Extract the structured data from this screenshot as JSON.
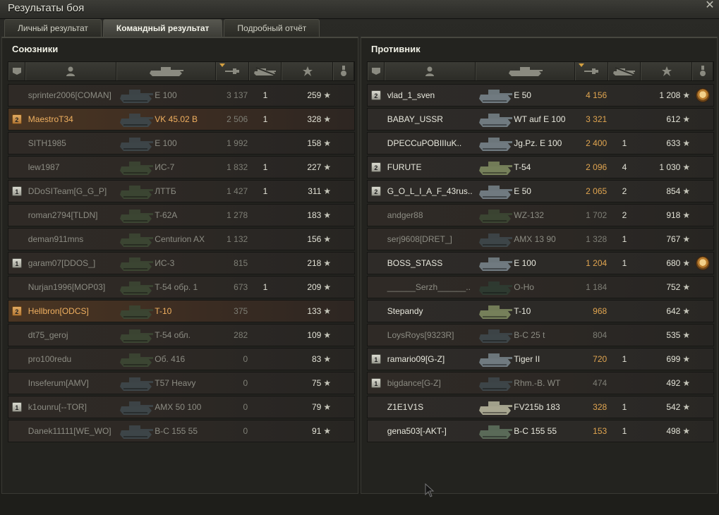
{
  "window": {
    "title": "Результаты боя",
    "close_icon": "close-icon"
  },
  "tabs": [
    {
      "label": "Личный результат",
      "active": false
    },
    {
      "label": "Командный результат",
      "active": true
    },
    {
      "label": "Подробный отчёт",
      "active": false
    }
  ],
  "allies": {
    "title": "Союзники",
    "columns": [
      {
        "icon": "platoon-icon"
      },
      {
        "icon": "player-icon"
      },
      {
        "icon": "tank-icon"
      },
      {
        "icon": "damage-icon",
        "sorted": true
      },
      {
        "icon": "kills-icon"
      },
      {
        "icon": "xp-star-icon"
      },
      {
        "icon": "medal-icon"
      }
    ],
    "rows": [
      {
        "platoon": "",
        "name": "sprinter2006[COMAN]",
        "vehicle": "E 100",
        "damage": "3 137",
        "kills": "1",
        "xp": "259",
        "state": "dead",
        "medal": false,
        "tank_color": "#3d4548"
      },
      {
        "platoon": "2",
        "platoon_color": "gold",
        "name": "MaestroT34",
        "vehicle": "VK 45.02 B",
        "damage": "2 506",
        "kills": "1",
        "xp": "328",
        "state": "highlight",
        "medal": false,
        "tank_color": "#3d4548"
      },
      {
        "platoon": "",
        "name": "SITH1985",
        "vehicle": "E 100",
        "damage": "1 992",
        "kills": "",
        "xp": "158",
        "state": "dead",
        "medal": false,
        "tank_color": "#3d4548"
      },
      {
        "platoon": "",
        "name": "lew1987",
        "vehicle": "ИС-7",
        "damage": "1 832",
        "kills": "1",
        "xp": "227",
        "state": "dead",
        "medal": false,
        "tank_color": "#3b4532"
      },
      {
        "platoon": "1",
        "platoon_color": "silver",
        "name": "DDoSITeam[G_G_P]",
        "vehicle": "ЛТТБ",
        "damage": "1 427",
        "kills": "1",
        "xp": "311",
        "state": "dead",
        "medal": false,
        "tank_color": "#3b4532"
      },
      {
        "platoon": "",
        "name": "roman2794[TLDN]",
        "vehicle": "T-62A",
        "damage": "1 278",
        "kills": "",
        "xp": "183",
        "state": "dead",
        "medal": false,
        "tank_color": "#3b4532"
      },
      {
        "platoon": "",
        "name": "deman911mns",
        "vehicle": "Centurion AX",
        "damage": "1 132",
        "kills": "",
        "xp": "156",
        "state": "dead",
        "medal": false,
        "tank_color": "#3b4532"
      },
      {
        "platoon": "1",
        "platoon_color": "silver",
        "name": "garam07[DDOS_]",
        "vehicle": "ИС-3",
        "damage": "815",
        "kills": "",
        "xp": "218",
        "state": "dead",
        "medal": false,
        "tank_color": "#3b4532"
      },
      {
        "platoon": "",
        "name": "Nurjan1996[MOP03]",
        "vehicle": "T-54 обр. 1",
        "damage": "673",
        "kills": "1",
        "xp": "209",
        "state": "dead",
        "medal": false,
        "tank_color": "#3b4532"
      },
      {
        "platoon": "2",
        "platoon_color": "gold",
        "name": "Hellbron[ODCS]",
        "vehicle": "T-10",
        "damage": "375",
        "kills": "",
        "xp": "133",
        "state": "highlight",
        "medal": false,
        "tank_color": "#3b4532"
      },
      {
        "platoon": "",
        "name": "dt75_geroj",
        "vehicle": "T-54 обл.",
        "damage": "282",
        "kills": "",
        "xp": "109",
        "state": "dead",
        "medal": false,
        "tank_color": "#3b4532"
      },
      {
        "platoon": "",
        "name": "pro100redu",
        "vehicle": "Об. 416",
        "damage": "0",
        "kills": "",
        "xp": "83",
        "state": "dead",
        "medal": false,
        "tank_color": "#3b4532"
      },
      {
        "platoon": "",
        "name": "Inseferum[AMV]",
        "vehicle": "T57 Heavy",
        "damage": "0",
        "kills": "",
        "xp": "75",
        "state": "dead",
        "medal": false,
        "tank_color": "#3d4548"
      },
      {
        "platoon": "1",
        "platoon_color": "silver",
        "name": "k1ounru[--TOR]",
        "vehicle": "AMX 50 100",
        "damage": "0",
        "kills": "",
        "xp": "79",
        "state": "dead",
        "medal": false,
        "tank_color": "#3d4548"
      },
      {
        "platoon": "",
        "name": "Danek11111[WE_WO]",
        "vehicle": "B-C 155 55",
        "damage": "0",
        "kills": "",
        "xp": "91",
        "state": "dead",
        "medal": false,
        "tank_color": "#3d4548"
      }
    ]
  },
  "enemies": {
    "title": "Противник",
    "rows": [
      {
        "platoon": "2",
        "platoon_color": "silver",
        "name": "vlad_1_sven",
        "vehicle": "E 50",
        "damage": "4 156",
        "kills": "",
        "xp": "1 208",
        "state": "alive",
        "medal": true,
        "tank_color": "#707a80"
      },
      {
        "platoon": "",
        "name": "BABAY_USSR",
        "vehicle": "WT auf E 100",
        "damage": "3 321",
        "kills": "",
        "xp": "612",
        "state": "alive",
        "medal": false,
        "tank_color": "#707a80"
      },
      {
        "platoon": "",
        "name": "DPECCuPOBIIIuK..",
        "vehicle": "Jg.Pz. E 100",
        "damage": "2 400",
        "kills": "1",
        "xp": "633",
        "state": "alive",
        "medal": false,
        "tank_color": "#707a80"
      },
      {
        "platoon": "2",
        "platoon_color": "silver",
        "name": "FURUTE",
        "vehicle": "T-54",
        "damage": "2 096",
        "kills": "4",
        "xp": "1 030",
        "state": "alive",
        "medal": false,
        "tank_color": "#76805a"
      },
      {
        "platoon": "2",
        "platoon_color": "silver",
        "name": "G_O_L_I_A_F_43rus..",
        "vehicle": "E 50",
        "damage": "2 065",
        "kills": "2",
        "xp": "854",
        "state": "alive",
        "medal": false,
        "tank_color": "#707a80"
      },
      {
        "platoon": "",
        "name": "andger88",
        "vehicle": "WZ-132",
        "damage": "1 702",
        "kills": "2",
        "xp": "918",
        "state": "dead",
        "medal": false,
        "tank_color": "#3b4532"
      },
      {
        "platoon": "",
        "name": "serj9608[DRET_]",
        "vehicle": "AMX 13 90",
        "damage": "1 328",
        "kills": "1",
        "xp": "767",
        "state": "dead",
        "medal": false,
        "tank_color": "#3d4548"
      },
      {
        "platoon": "",
        "name": "BOSS_STASS",
        "vehicle": "E 100",
        "damage": "1 204",
        "kills": "1",
        "xp": "680",
        "state": "alive",
        "medal": true,
        "tank_color": "#707a80"
      },
      {
        "platoon": "",
        "name": "______Serzh______..",
        "vehicle": "O-Ho",
        "damage": "1 184",
        "kills": "",
        "xp": "752",
        "state": "dead",
        "medal": false,
        "tank_color": "#2e3a30"
      },
      {
        "platoon": "",
        "name": "Stepandy",
        "vehicle": "T-10",
        "damage": "968",
        "kills": "",
        "xp": "642",
        "state": "alive",
        "medal": false,
        "tank_color": "#76805a"
      },
      {
        "platoon": "",
        "name": "LoysRoys[9323R]",
        "vehicle": "B-C 25 t",
        "damage": "804",
        "kills": "",
        "xp": "535",
        "state": "dead",
        "medal": false,
        "tank_color": "#3d4548"
      },
      {
        "platoon": "1",
        "platoon_color": "silver",
        "name": "ramario09[G-Z]",
        "vehicle": "Tiger II",
        "damage": "720",
        "kills": "1",
        "xp": "699",
        "state": "alive",
        "medal": false,
        "tank_color": "#707a80"
      },
      {
        "platoon": "1",
        "platoon_color": "silver",
        "name": "bigdance[G-Z]",
        "vehicle": "Rhm.-B. WT",
        "damage": "474",
        "kills": "",
        "xp": "492",
        "state": "dead",
        "medal": false,
        "tank_color": "#3d4548"
      },
      {
        "platoon": "",
        "name": "Z1E1V1S",
        "vehicle": "FV215b 183",
        "damage": "328",
        "kills": "1",
        "xp": "542",
        "state": "alive",
        "medal": false,
        "tank_color": "#a8a690"
      },
      {
        "platoon": "",
        "name": "gena503[-AKT-]",
        "vehicle": "B-C 155 55",
        "damage": "153",
        "kills": "1",
        "xp": "498",
        "state": "alive",
        "medal": false,
        "tank_color": "#5a6a58"
      }
    ]
  },
  "colors": {
    "accent_orange": "#e0a550",
    "highlight_name": "#f0b060",
    "dead_text": "#8c8c83",
    "alive_text": "#e8e8dd"
  }
}
